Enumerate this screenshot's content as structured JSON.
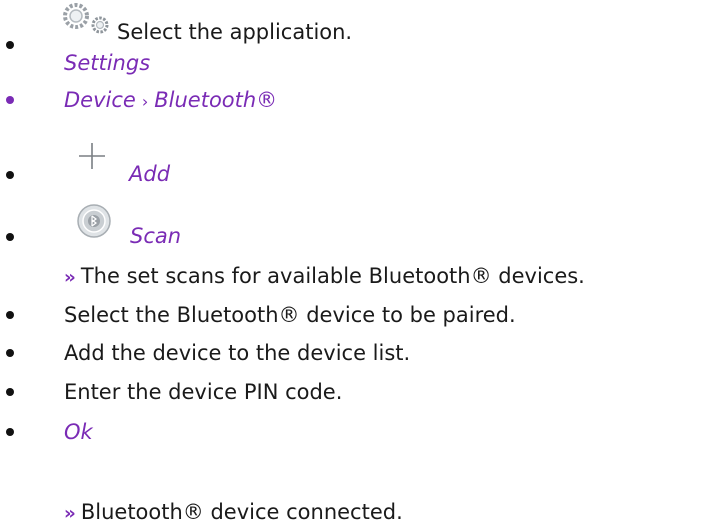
{
  "colors": {
    "accent": "#7a2bb5",
    "text": "#1a1a1a"
  },
  "steps": [
    {
      "icon": "gears-icon",
      "text": "Select the application.",
      "sub": "Settings"
    },
    {
      "path_a": "Device",
      "separator": "›",
      "path_b": "Bluetooth®"
    },
    {
      "icon": "plus-icon",
      "label": "Add"
    },
    {
      "icon": "bluetooth-scan-icon",
      "label": "Scan",
      "result_marker": "››",
      "result": "The set scans for available Bluetooth® devices."
    },
    {
      "text": "Select the Bluetooth® device to be paired."
    },
    {
      "text": "Add the device to the device list."
    },
    {
      "text": "Enter the device PIN code."
    },
    {
      "label": "Ok",
      "result_marker": "››",
      "result": "Bluetooth® device connected."
    }
  ]
}
